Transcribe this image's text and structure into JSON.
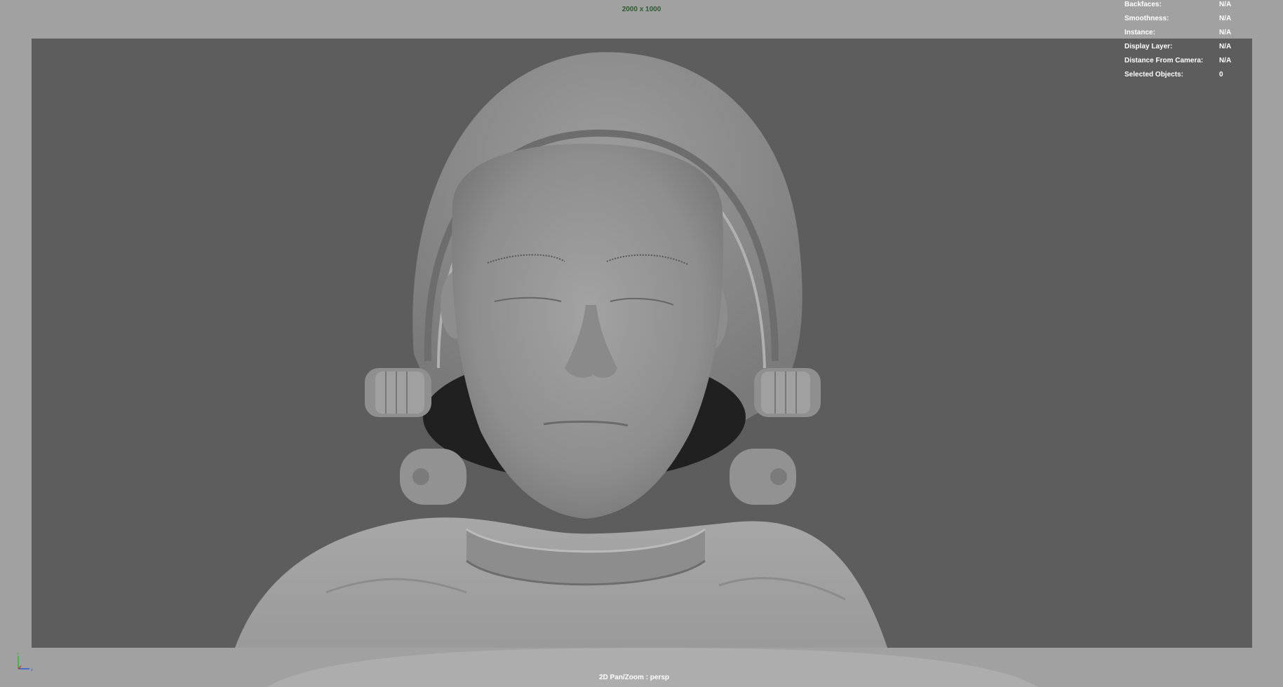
{
  "viewport": {
    "resolution": "2000 x 1000",
    "camera_label": "2D Pan/Zoom : persp"
  },
  "hud": [
    {
      "key": "Backfaces:",
      "value": "N/A"
    },
    {
      "key": "Smoothness:",
      "value": "N/A"
    },
    {
      "key": "Instance:",
      "value": "N/A"
    },
    {
      "key": "Display Layer:",
      "value": "N/A"
    },
    {
      "key": "Distance From Camera:",
      "value": "N/A"
    },
    {
      "key": "Selected Objects:",
      "value": "0"
    }
  ],
  "colors": {
    "viewport_bg": "#a1a1a1",
    "gate_bg": "#5d5d5d",
    "resolution_text": "#2f5a2f",
    "hud_text": "#ffffff"
  },
  "icons": {
    "axis": "view-axis-icon"
  }
}
